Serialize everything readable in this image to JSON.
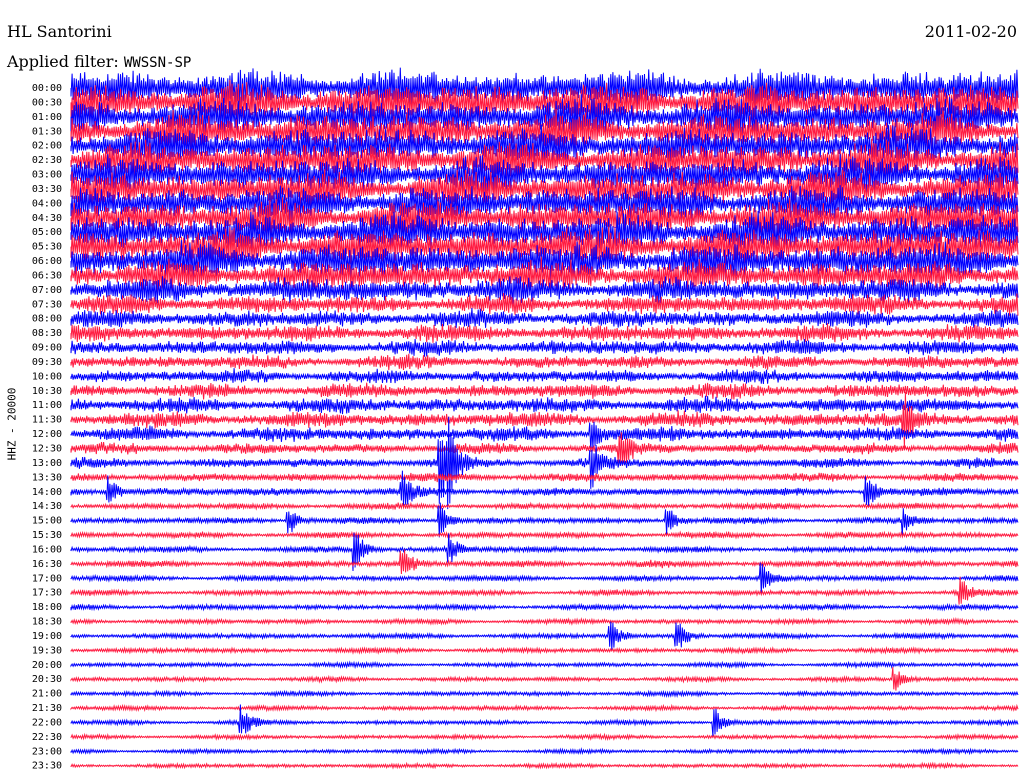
{
  "header": {
    "station": "HL Santorini",
    "date": "2011-02-20",
    "filter_label": "Applied filter: ",
    "filter_value": "WWSSN-SP"
  },
  "chart_data": {
    "type": "line",
    "title": "HL Santorini",
    "ylabel": "HHZ - 20000",
    "ytick_labels": [
      "00:00",
      "00:30",
      "01:00",
      "01:30",
      "02:00",
      "02:30",
      "03:00",
      "03:30",
      "04:00",
      "04:30",
      "05:00",
      "05:30",
      "06:00",
      "06:30",
      "07:00",
      "07:30",
      "08:00",
      "08:30",
      "09:00",
      "09:30",
      "10:00",
      "10:30",
      "11:00",
      "11:30",
      "12:00",
      "12:30",
      "13:00",
      "13:30",
      "14:00",
      "14:30",
      "15:00",
      "15:30",
      "16:00",
      "16:30",
      "17:00",
      "17:30",
      "18:00",
      "18:30",
      "19:00",
      "19:30",
      "20:00",
      "20:30",
      "21:00",
      "21:30",
      "22:00",
      "22:30",
      "23:00",
      "23:30"
    ],
    "colors": {
      "even_rows": "#0000ff",
      "odd_rows": "#ff1a40"
    },
    "noise_level": [
      0.95,
      0.95,
      0.92,
      0.92,
      0.9,
      0.9,
      0.88,
      0.86,
      0.88,
      0.9,
      0.9,
      0.92,
      0.9,
      0.75,
      0.6,
      0.45,
      0.4,
      0.4,
      0.35,
      0.3,
      0.3,
      0.32,
      0.35,
      0.35,
      0.32,
      0.22,
      0.2,
      0.16,
      0.15,
      0.1,
      0.1,
      0.1,
      0.1,
      0.12,
      0.09,
      0.08,
      0.08,
      0.07,
      0.08,
      0.07,
      0.06,
      0.06,
      0.06,
      0.06,
      0.06,
      0.05,
      0.05,
      0.05
    ],
    "events": [
      {
        "row": 26,
        "x": 0.39,
        "amplitude": 3.0
      },
      {
        "row": 26,
        "x": 0.4,
        "amplitude": 2.0
      },
      {
        "row": 26,
        "x": 0.55,
        "amplitude": 1.6
      },
      {
        "row": 25,
        "x": 0.58,
        "amplitude": 1.5
      },
      {
        "row": 24,
        "x": 0.55,
        "amplitude": 1.2
      },
      {
        "row": 23,
        "x": 0.88,
        "amplitude": 1.8
      },
      {
        "row": 28,
        "x": 0.04,
        "amplitude": 1.0
      },
      {
        "row": 28,
        "x": 0.35,
        "amplitude": 1.2
      },
      {
        "row": 28,
        "x": 0.84,
        "amplitude": 1.4
      },
      {
        "row": 30,
        "x": 0.23,
        "amplitude": 1.1
      },
      {
        "row": 30,
        "x": 0.39,
        "amplitude": 1.2
      },
      {
        "row": 30,
        "x": 0.63,
        "amplitude": 1.0
      },
      {
        "row": 30,
        "x": 0.88,
        "amplitude": 0.9
      },
      {
        "row": 32,
        "x": 0.3,
        "amplitude": 1.4
      },
      {
        "row": 32,
        "x": 0.4,
        "amplitude": 1.1
      },
      {
        "row": 33,
        "x": 0.35,
        "amplitude": 1.2
      },
      {
        "row": 34,
        "x": 0.73,
        "amplitude": 1.0
      },
      {
        "row": 35,
        "x": 0.94,
        "amplitude": 1.0
      },
      {
        "row": 38,
        "x": 0.57,
        "amplitude": 1.1
      },
      {
        "row": 38,
        "x": 0.64,
        "amplitude": 1.3
      },
      {
        "row": 41,
        "x": 0.87,
        "amplitude": 0.8
      },
      {
        "row": 44,
        "x": 0.18,
        "amplitude": 1.2
      },
      {
        "row": 44,
        "x": 0.68,
        "amplitude": 1.0
      }
    ]
  }
}
